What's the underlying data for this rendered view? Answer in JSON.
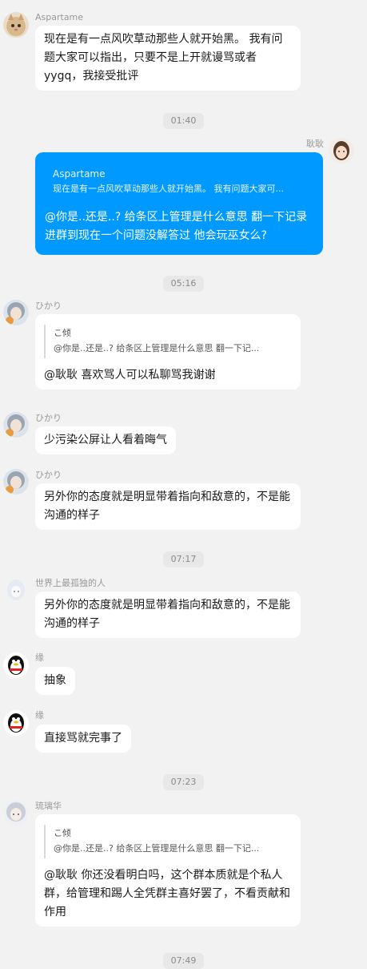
{
  "messages": [
    {
      "sender": "Aspartame",
      "text": "现在是有一点风吹草动那些人就开始黑。 我有问题大家可以指出，只要不是上开就谩骂或者yygq，我接受批评"
    },
    {
      "time": "01:40"
    },
    {
      "sender": "耿耿",
      "mine": true,
      "quote_name": "Aspartame",
      "quote_text": "现在是有一点风吹草动那些人就开始黑。 我有问题大家可...",
      "text": "@你是..还是..?  给条区上管理是什么意思 翻一下记录 进群到现在一个问题没解答过 他会玩巫女么?"
    },
    {
      "time": "05:16"
    },
    {
      "sender": "ひかり",
      "quote_name": "こ倾",
      "quote_text": "@你是..还是..?  给条区上管理是什么意思 翻一下记...",
      "text": "@耿耿 喜欢骂人可以私聊骂我谢谢"
    },
    {
      "sender": "ひかり",
      "text": "少污染公屏让人看着晦气"
    },
    {
      "sender": "ひかり",
      "text": "另外你的态度就是明显带着指向和敌意的，不是能沟通的样子"
    },
    {
      "time": "07:17"
    },
    {
      "sender": "世界上最孤独的人",
      "text": "另外你的态度就是明显带着指向和敌意的，不是能沟通的样子"
    },
    {
      "sender": "缘",
      "text": "抽象"
    },
    {
      "sender": "缘",
      "text": "直接骂就完事了"
    },
    {
      "time": "07:23"
    },
    {
      "sender": "琉璃华",
      "quote_name": "こ倾",
      "quote_text": "@你是..还是..?  给条区上管理是什么意思 翻一下记...",
      "text": "@耿耿 你还没看明白吗，这个群本质就是个私人群，给管理和踢人全凭群主喜好罢了，不看贡献和作用"
    },
    {
      "time": "07:49"
    }
  ],
  "colors": {
    "mine": "#0099ff",
    "background": "#f2f2f2",
    "bubble": "#ffffff"
  },
  "icons": {
    "qq_avatar": "penguin-icon"
  }
}
